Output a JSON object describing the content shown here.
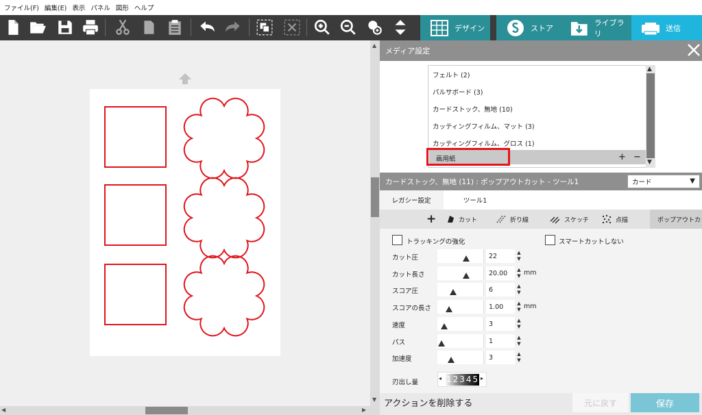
{
  "menu": [
    "ファイル(F)",
    "編集(E)",
    "表示",
    "パネル",
    "図形",
    "ヘルプ"
  ],
  "nav_tabs": {
    "design": "デザイン",
    "store": "ストア",
    "library": "ライブラリ",
    "send": "送信"
  },
  "colors": {
    "toolbar_bg": "#3b3b3b",
    "send_tab": "#1fb5dd",
    "nav_tab_bg": "#2a8f96",
    "shape_stroke": "#e0141c",
    "panel_header": "#8f8f8f",
    "save_button": "#7bc6d6"
  },
  "media_panel": {
    "title": "メディア設定",
    "items": [
      "フェルト (2)",
      "パルサボード (3)",
      "カードストック、無地 (10)",
      "カッティングフィルム、マット (3)",
      "カッティングフィルム、グロス (1)",
      "画用紙"
    ],
    "selected_index": 5,
    "add_label": "+",
    "remove_label": "−"
  },
  "tool_header": {
    "title": "カードストック、無地 (11) : ポップアウトカット - ツール1",
    "select_value": "カード"
  },
  "tabs": [
    "レガシー設定",
    "ツール1"
  ],
  "modes": {
    "add": "+",
    "cut": "カット",
    "fold": "折り線",
    "sketch": "スケッチ",
    "dots": "点描",
    "popout": "ポップアウトカット"
  },
  "settings": {
    "tracking_label": "トラッキングの強化",
    "smart_cut_label": "スマートカットしない",
    "unit": "mm",
    "rows": [
      {
        "label": "カット圧",
        "value": "22",
        "level": 0.62,
        "unit": false
      },
      {
        "label": "カット長さ",
        "value": "20.00",
        "level": 0.62,
        "unit": true
      },
      {
        "label": "スコア圧",
        "value": "6",
        "level": 0.3,
        "unit": false
      },
      {
        "label": "スコアの長さ",
        "value": "1.00",
        "level": 0.2,
        "unit": true
      },
      {
        "label": "速度",
        "value": "3",
        "level": 0.08,
        "unit": false
      },
      {
        "label": "パス",
        "value": "1",
        "level": 0.02,
        "unit": false
      },
      {
        "label": "加速度",
        "value": "3",
        "level": 0.25,
        "unit": false
      }
    ],
    "blade_label": "刃出し量",
    "blade_digits": "12345"
  },
  "footer": {
    "delete_action": "アクションを削除する",
    "undo": "元に戻す",
    "save": "保存"
  }
}
